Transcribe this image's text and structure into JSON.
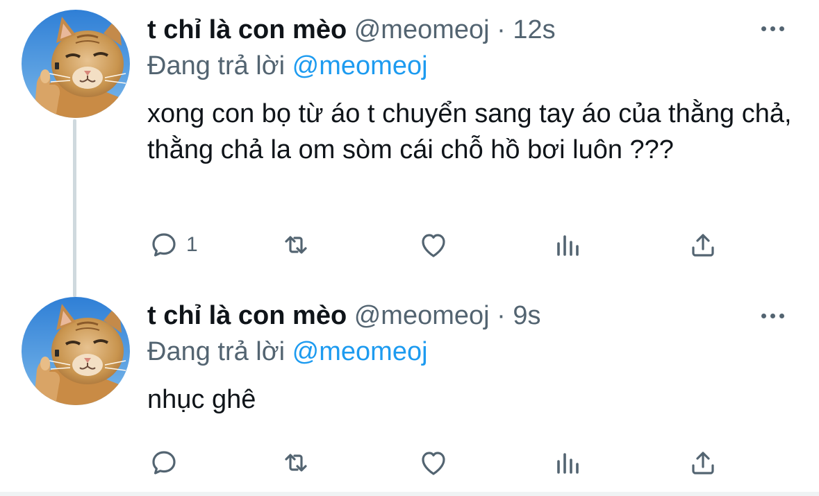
{
  "colors": {
    "text_primary": "#0f1419",
    "text_secondary": "#536471",
    "mention_blue": "#1d9bf0",
    "thread_line": "#cfd9de"
  },
  "tweets": [
    {
      "display_name": "t chỉ là con mèo",
      "handle": "@meomeoj",
      "separator": "·",
      "time": "12s",
      "replying_prefix": "Đang trả lời",
      "replying_to": "@meomeoj",
      "text": "xong con bọ từ áo t chuyển sang tay áo của thằng chả, thằng chả la om sòm cái chỗ hồ bơi luôn ???",
      "reply_count": "1",
      "icons": [
        "reply-icon",
        "retweet-icon",
        "like-icon",
        "analytics-icon",
        "share-icon",
        "more-icon"
      ]
    },
    {
      "display_name": "t chỉ là con mèo",
      "handle": "@meomeoj",
      "separator": "·",
      "time": "9s",
      "replying_prefix": "Đang trả lời",
      "replying_to": "@meomeoj",
      "text": "nhục ghê",
      "reply_count": "",
      "icons": [
        "reply-icon",
        "retweet-icon",
        "like-icon",
        "analytics-icon",
        "share-icon",
        "more-icon"
      ]
    }
  ]
}
